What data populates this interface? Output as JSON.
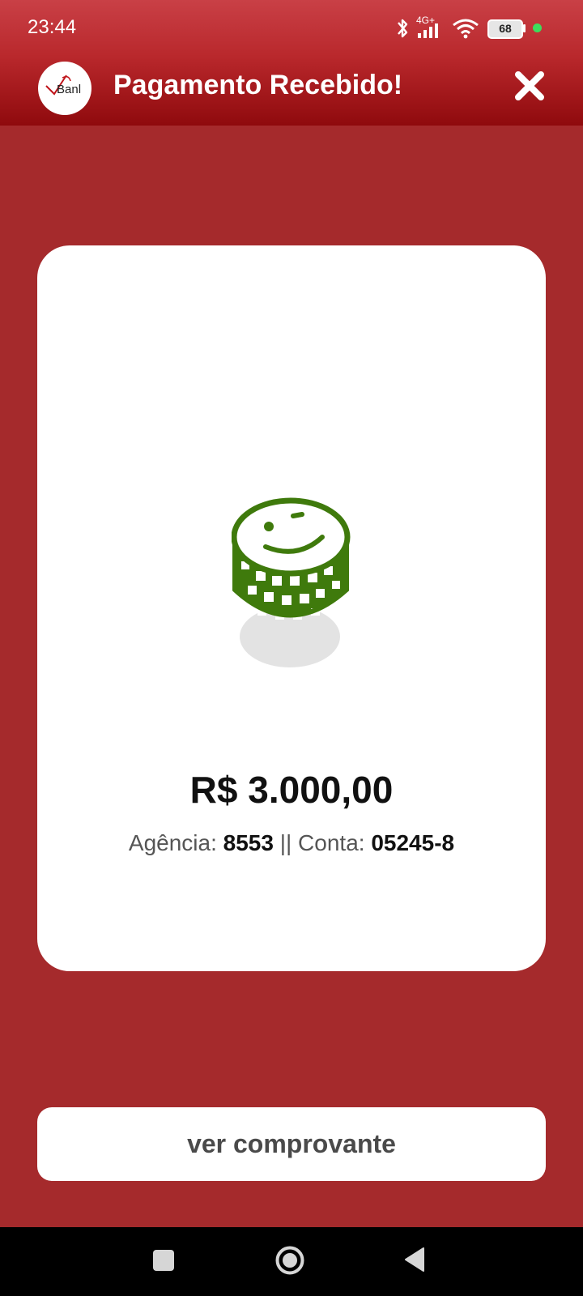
{
  "status_bar": {
    "time": "23:44",
    "network": "4G+",
    "battery": "68",
    "icons": [
      "bluetooth-icon",
      "signal-icon",
      "wifi-icon",
      "battery-icon",
      "privacy-dot-icon"
    ],
    "dot_color": "#3ddc5c"
  },
  "header": {
    "logo_text": "Banl",
    "title": "Pagamento Recebido!",
    "close_icon": "close-icon"
  },
  "card": {
    "illustration": "smiling-coin-stack-icon",
    "coin_color": "#3f7a0c",
    "amount": "R$ 3.000,00",
    "agency_label": "Agência:",
    "agency_value": "8553",
    "separator": "||",
    "account_label": "Conta:",
    "account_value": "05245-8"
  },
  "actions": {
    "receipt_button": "ver comprovante"
  },
  "nav_bar": {
    "buttons": [
      "recents-icon",
      "home-icon",
      "back-icon"
    ]
  },
  "colors": {
    "background": "#a52a2c",
    "header_top": "#c94046",
    "header_bottom": "#8f0a0d",
    "card": "#ffffff",
    "button_text": "#4a4a4a"
  }
}
